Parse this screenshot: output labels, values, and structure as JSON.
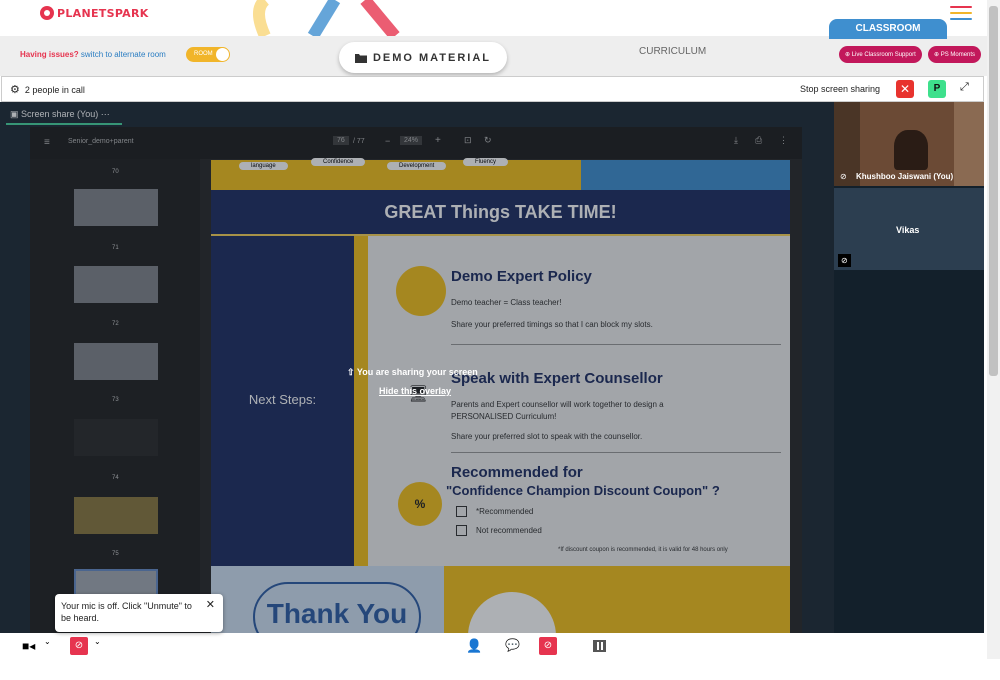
{
  "brand": {
    "name": "PLANETSPARK"
  },
  "colors": {
    "brand_red": "#e6344f",
    "classroom_blue": "#3f8fcf",
    "pill_red": "#c2185b",
    "share_green": "#4ad6a0",
    "navy": "#1f2e63",
    "yellow": "#f3c01c"
  },
  "header": {
    "issues_text": "Having issues?",
    "switch_link": "switch to alternate room",
    "toggle_label": "ROOM",
    "demo_material": "DEMO MATERIAL",
    "curriculum": "CURRICULUM",
    "classroom_tab": "CLASSROOM",
    "live_support": "Live Classroom Support",
    "ps_moments": "PS Moments",
    "menu_icon": "hamburger-menu-icon"
  },
  "callbar": {
    "people": "2 people in call",
    "stop_sharing": "Stop screen sharing",
    "participant_initial": "P"
  },
  "stage": {
    "tab_label": "Screen share (You)",
    "tab_menu": "⋯"
  },
  "pdf_viewer": {
    "filename": "Senior_demo+parent",
    "page_current": "76",
    "page_total": "/ 77",
    "zoom": "24%",
    "thumb_numbers": [
      "70",
      "71",
      "72",
      "73",
      "74",
      "75"
    ]
  },
  "slide": {
    "top_labels": [
      "language",
      "Confidence",
      "Development",
      "Fluency"
    ],
    "banner": "GREAT Things TAKE TIME!",
    "left_title": "Next Steps:",
    "s1_title": "Demo Expert Policy",
    "s1_line1": "Demo teacher = Class teacher!",
    "s1_line2": "Share your preferred timings so that I can block my slots.",
    "s2_title": "Speak with Expert Counsellor",
    "s2_line1": "Parents and Expert counsellor will work together to design a",
    "s2_line2": "PERSONALISED Curriculum!",
    "s2_line3": "Share your preferred slot to speak with the counsellor.",
    "s3_title": "Recommended for",
    "s3_subtitle": "\"Confidence Champion Discount Coupon\" ?",
    "opt1": "*Recommended",
    "opt2": "Not recommended",
    "footnote": "*If discount coupon is recommended, it is valid for 48 hours only",
    "percent": "%",
    "thanks": "Thank You"
  },
  "overlay": {
    "message": "You are sharing your screen",
    "hide_link": "Hide this overlay"
  },
  "participants": [
    {
      "name": "Khushboo Jaiswani (You)"
    },
    {
      "name": "Vikas"
    }
  ],
  "toast": {
    "text": "Your mic is off. Click \"Unmute\" to be heard.",
    "close": "✕"
  }
}
